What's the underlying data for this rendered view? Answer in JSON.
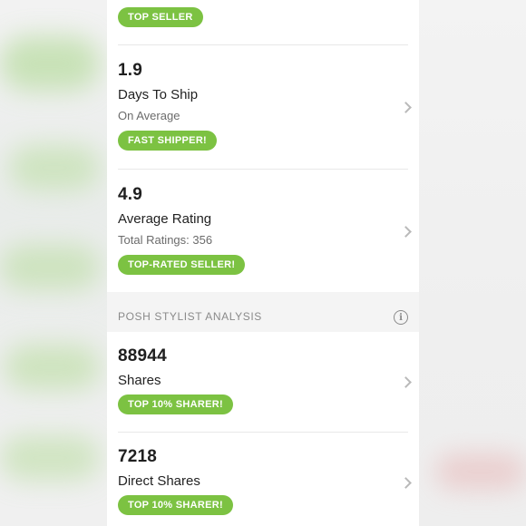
{
  "rows": [
    {
      "badge": "TOP SELLER"
    },
    {
      "value": "1.9",
      "title": "Days To Ship",
      "subtitle": "On Average",
      "badge": "FAST SHIPPER!"
    },
    {
      "value": "4.9",
      "title": "Average Rating",
      "subtitle": "Total Ratings: 356",
      "badge": "TOP-RATED SELLER!"
    }
  ],
  "section": {
    "title": "POSH STYLIST ANALYSIS",
    "info_icon": "info-icon"
  },
  "stylist_rows": [
    {
      "value": "88944",
      "title": "Shares",
      "badge": "TOP 10% SHARER!"
    },
    {
      "value": "7218",
      "title": "Direct Shares",
      "badge": "TOP 10% SHARER!"
    }
  ],
  "colors": {
    "badge": "#7cc242",
    "section_bg": "#f4f4f4",
    "text": "#222222",
    "muted": "#6b6b6b"
  }
}
